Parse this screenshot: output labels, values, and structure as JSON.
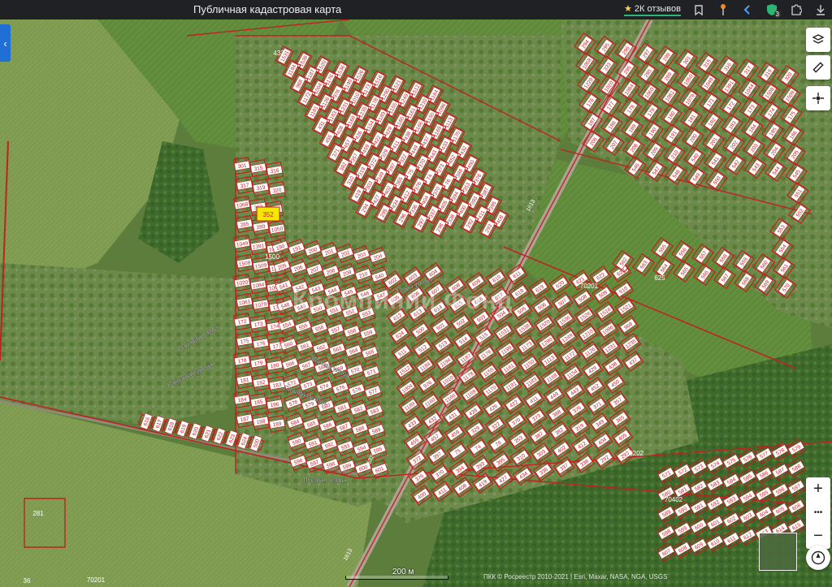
{
  "header": {
    "title": "Публичная кадастровая карта",
    "reviews_label": "2К отзывов",
    "reviews_star": "★",
    "shield_badge": "3",
    "icons": [
      "bookmark-icon",
      "pin-icon",
      "back-icon",
      "shield-icon",
      "puzzle-icon",
      "download-icon"
    ]
  },
  "map": {
    "watermark": "Кромпинии Фонц",
    "quarter_labels": [
      {
        "text": "433"
      },
      {
        "text": "625"
      },
      {
        "text": "70201"
      },
      {
        "text": "70202"
      },
      {
        "text": "70402"
      },
      {
        "text": "70201"
      },
      {
        "text": "281"
      },
      {
        "text": "36"
      },
      {
        "text": "1500"
      }
    ],
    "street_labels": [
      {
        "text": "Садовая улица"
      },
      {
        "text": "Радужная улица"
      },
      {
        "text": "Луговая улица"
      },
      {
        "text": "Тихая улица"
      },
      {
        "text": "Мирная улица"
      },
      {
        "text": "Садовая улица"
      }
    ],
    "highlight_parcel": "352",
    "parcel_numbers": [
      "1531",
      "1538",
      "1520",
      "1536",
      "1526",
      "1516",
      "1521",
      "1512",
      "1184",
      "1194",
      "1187",
      "1176",
      "1199",
      "1173",
      "1290",
      "1249",
      "1210",
      "1096",
      "968",
      "1004",
      "976",
      "1010",
      "1178",
      "1155",
      "1161",
      "1150",
      "1113",
      "1172",
      "1126",
      "1231",
      "1235",
      "1189",
      "1160",
      "1166",
      "1169",
      "1170",
      "1181",
      "1183",
      "1168",
      "1154",
      "429",
      "438",
      "437",
      "433",
      "432",
      "431",
      "428",
      "426",
      "422",
      "411",
      "449",
      "443",
      "452",
      "450",
      "455",
      "457",
      "459",
      "329",
      "322",
      "370",
      "373",
      "388",
      "376",
      "371",
      "357",
      "372",
      "397",
      "75",
      "74",
      "76",
      "353",
      "387",
      "382",
      "319",
      "349",
      "365",
      "376",
      "370",
      "394",
      "393",
      "395",
      "310",
      "303",
      "402",
      "412",
      "404",
      "405",
      "400",
      "411",
      "408",
      "419",
      "427",
      "434",
      "336",
      "337",
      "338",
      "292",
      "293",
      "294",
      "295",
      "296",
      "297",
      "298",
      "301",
      "315",
      "316",
      "317",
      "319",
      "320",
      "1068",
      "333",
      "295",
      "285",
      "289",
      "1050",
      "1049",
      "1391",
      "1044",
      "1508",
      "1509",
      "1229",
      "1020",
      "1084",
      "1060",
      "1081",
      "1079",
      "171",
      "172",
      "173",
      "174",
      "175",
      "176",
      "177",
      "178",
      "179",
      "180",
      "181",
      "182",
      "183",
      "184",
      "185",
      "186",
      "187",
      "188",
      "189",
      "190",
      "191",
      "200",
      "201",
      "202",
      "203",
      "204",
      "205",
      "206",
      "207",
      "208",
      "209",
      "210",
      "540",
      "541",
      "542",
      "543",
      "544",
      "545",
      "546",
      "547",
      "548",
      "549",
      "550",
      "551",
      "552",
      "553",
      "554",
      "555",
      "556",
      "557",
      "558",
      "559",
      "560",
      "561",
      "562",
      "563",
      "564",
      "565",
      "566",
      "567",
      "568",
      "569",
      "570",
      "571",
      "572",
      "573",
      "574",
      "575",
      "576",
      "577",
      "578",
      "579",
      "580",
      "581",
      "582",
      "583",
      "584",
      "585",
      "586",
      "587",
      "588",
      "589",
      "590",
      "591",
      "592",
      "593",
      "594",
      "595",
      "596",
      "597",
      "598",
      "599",
      "600",
      "601",
      "602",
      "603",
      "604",
      "605",
      "606",
      "607",
      "608",
      "609",
      "610",
      "611",
      "612",
      "613",
      "614",
      "615",
      "616",
      "617",
      "618",
      "619",
      "620",
      "621",
      "622",
      "623",
      "624",
      "500",
      "501",
      "502",
      "503",
      "504",
      "505",
      "506",
      "507",
      "508",
      "509",
      "510",
      "511",
      "512",
      "513",
      "514",
      "515"
    ],
    "road_labels": [
      "1613",
      "1632",
      "1613"
    ]
  },
  "controls": {
    "zoom_in": "+",
    "zoom_more": "•••",
    "zoom_out": "−",
    "side_toggle": "‹"
  },
  "scale": {
    "label": "200 м"
  },
  "attribution": "ПКК © Росреестр 2010-2021 | Esri, Maxar, NASA, NGA, USGS"
}
